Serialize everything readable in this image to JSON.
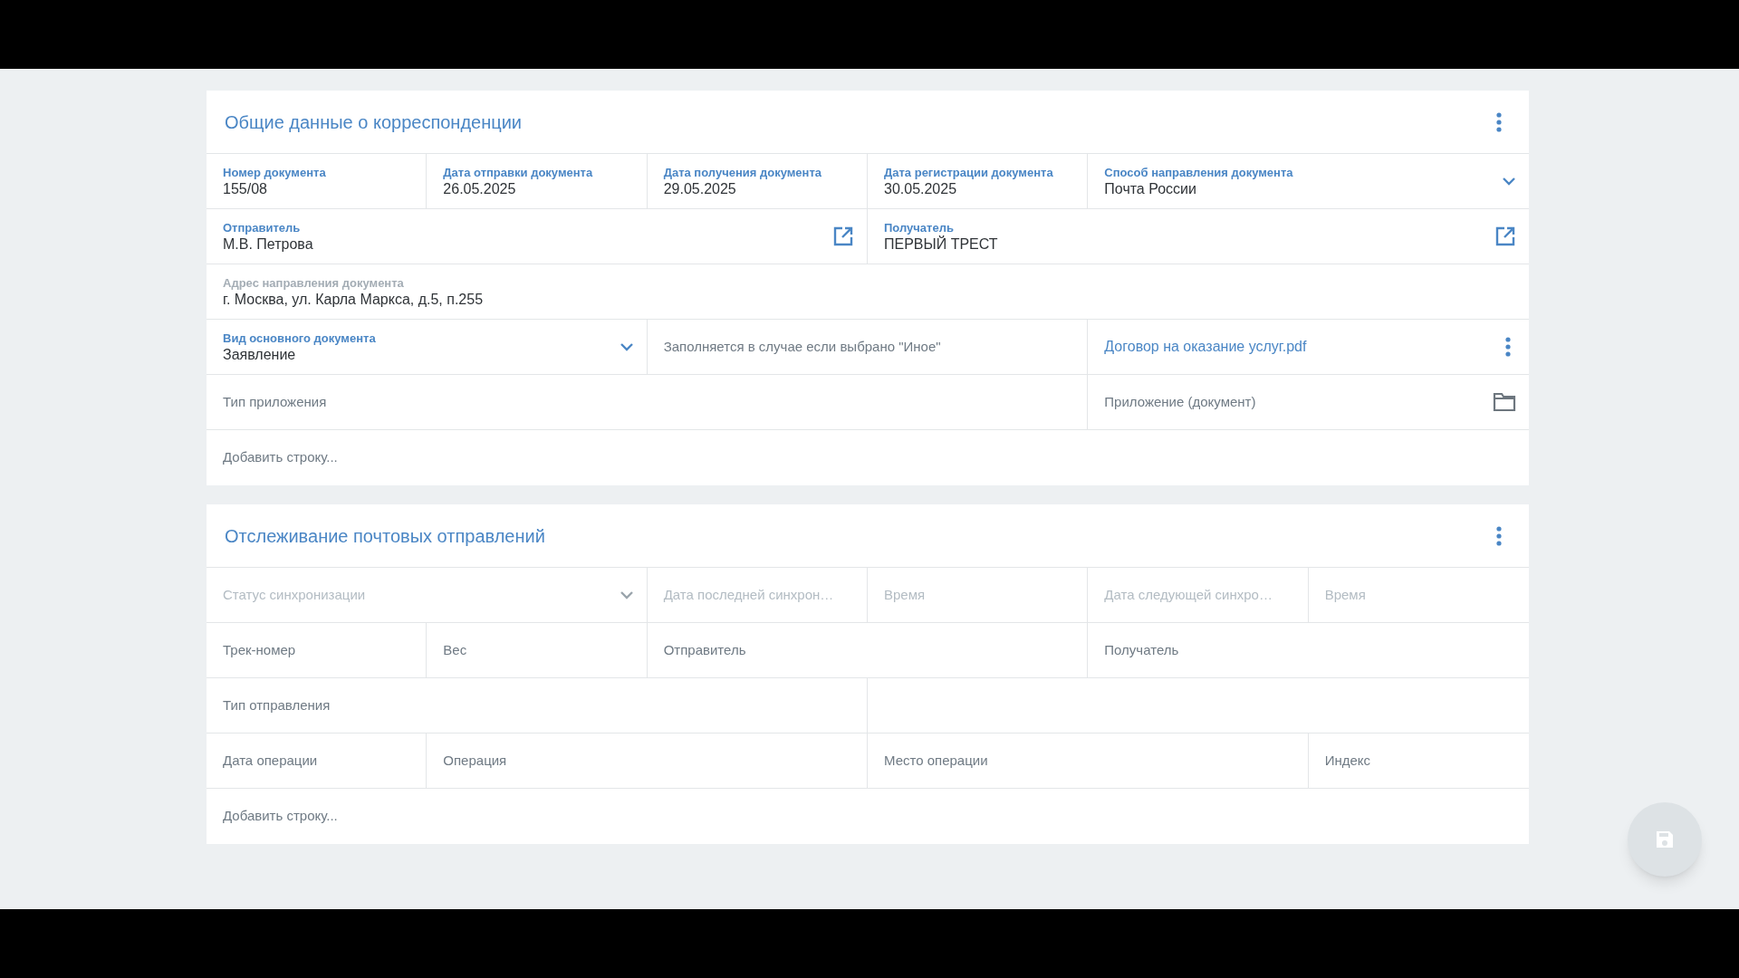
{
  "cards": [
    {
      "title": "Общие данные о корреспонденции",
      "fields": [
        {
          "kind": "text",
          "label": "Номер документа",
          "value": "155/08",
          "disabled": false
        },
        {
          "kind": "text",
          "label": "Дата отправки документа",
          "value": "26.05.2025",
          "disabled": false
        },
        {
          "kind": "text",
          "label": "Дата получения документа",
          "value": "29.05.2025",
          "disabled": false
        },
        {
          "kind": "text",
          "label": "Дата регистрации документа",
          "value": "30.05.2025",
          "disabled": false
        },
        {
          "kind": "select",
          "label": "Способ направления документа",
          "value": "Почта России",
          "disabled": false
        },
        {
          "kind": "reference",
          "label": "Отправитель",
          "value": "М.В. Петрова",
          "disabled": false
        },
        {
          "kind": "reference",
          "label": "Получатель",
          "value": "ПЕРВЫЙ ТРЕСТ",
          "disabled": false
        },
        {
          "kind": "readonly",
          "label": "Адрес направления документа",
          "value": "г. Москва, ул. Карла Маркса, д.5, п.255",
          "disabled": false
        },
        {
          "kind": "select",
          "label": "Вид основного документа",
          "value": "Заявление",
          "disabled": false
        },
        {
          "kind": "text",
          "placeholder": "Заполняется в случае если выбрано \"Иное\"",
          "disabled": false
        },
        {
          "kind": "attachment",
          "value": "Договор на оказание услуг.pdf",
          "disabled": false
        },
        {
          "kind": "text",
          "placeholder": "Тип приложения",
          "disabled": false
        },
        {
          "kind": "upload",
          "placeholder": "Приложение (документ)",
          "disabled": false
        },
        {
          "kind": "add",
          "placeholder": "Добавить строку...",
          "disabled": false
        }
      ]
    },
    {
      "title": "Отслеживание почтовых отправлений",
      "fields": [
        {
          "kind": "select",
          "placeholder": "Статус синхронизации",
          "disabled": true
        },
        {
          "kind": "text",
          "placeholder": "Дата последней синхрон…",
          "disabled": true
        },
        {
          "kind": "text",
          "placeholder": "Время",
          "disabled": true
        },
        {
          "kind": "text",
          "placeholder": "Дата следующей синхро…",
          "disabled": true
        },
        {
          "kind": "text",
          "placeholder": "Время",
          "disabled": true
        },
        {
          "kind": "text",
          "placeholder": "Трек-номер",
          "disabled": false
        },
        {
          "kind": "text",
          "placeholder": "Вес",
          "disabled": false
        },
        {
          "kind": "text",
          "placeholder": "Отправитель",
          "disabled": false
        },
        {
          "kind": "text",
          "placeholder": "Получатель",
          "disabled": false
        },
        {
          "kind": "text",
          "placeholder": "Тип отправления",
          "disabled": false
        },
        {
          "kind": "text",
          "placeholder": "Дата операции",
          "disabled": false
        },
        {
          "kind": "text",
          "placeholder": "Операция",
          "disabled": false
        },
        {
          "kind": "text",
          "placeholder": "Место операции",
          "disabled": false
        },
        {
          "kind": "text",
          "placeholder": "Индекс",
          "disabled": false
        },
        {
          "kind": "add",
          "placeholder": "Добавить строку...",
          "disabled": false
        }
      ]
    }
  ]
}
